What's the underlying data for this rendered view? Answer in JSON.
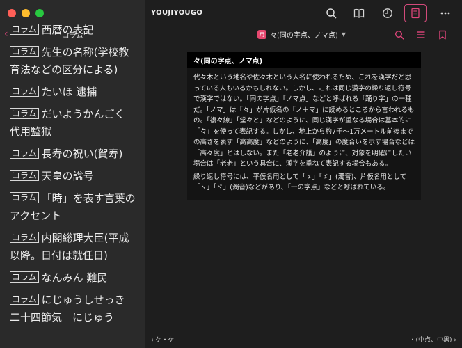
{
  "window": {
    "app_title": "YOUJIYOUGO"
  },
  "sidebar": {
    "title": "コラム",
    "items": [
      {
        "tag": "コラム",
        "text": "西暦の表記"
      },
      {
        "tag": "コラム",
        "text": "先生の名称(学校教育法などの区分による)"
      },
      {
        "tag": "コラム",
        "text": "たいほ 逮捕"
      },
      {
        "tag": "コラム",
        "text": "だいようかんごく 代用監獄"
      },
      {
        "tag": "コラム",
        "text": "長寿の祝い(賀寿)"
      },
      {
        "tag": "コラム",
        "text": "天皇の諡号"
      },
      {
        "tag": "コラム",
        "text": "「時」を表す言葉のアクセント"
      },
      {
        "tag": "コラム",
        "text": "内閣総理大臣(平成以降。日付は就任日)"
      },
      {
        "tag": "コラム",
        "text": "なんみん 難民"
      },
      {
        "tag": "コラム",
        "text": "にじゅうしせっき 二十四節気　にじゅう"
      }
    ]
  },
  "toolbar": {
    "icons": [
      "search-icon",
      "book-icon",
      "history-icon",
      "document-icon",
      "more-icon"
    ]
  },
  "subbar": {
    "app_icon_label": "用",
    "article_title": "々(同の字点、ノマ点)"
  },
  "article": {
    "heading": "々(同の字点、ノマ点)",
    "paragraph1": "代々木という地名や佐々木という人名に使われるため、これを漢字だと思っている人もいるかもしれない。しかし、これは同じ漢字の繰り返し符号で漢字ではない。「同の字点」「ノマ点」などと呼ばれる「踊り字」の一種だ。「ノマ」は「々」が片仮名の「ノ＋マ」に読めるところから言われるもの。「複々線」「堂々と」などのように、同じ漢字が重なる場合は基本的に「々」を使って表記する。しかし、地上から約7千〜1万メートル前後までの高さを表す「高高度」などのように、「高度」の度合いを示す場合などは「高々度」とはしない。また「老老介護」のように、対象を明確にしたい場合は「老老」という具合に、漢字を重ねて表記する場合もある。",
    "paragraph2": "繰り返し符号には、平仮名用として「ゝ」「ゞ」(濁音)、片仮名用として「ヽ」「ヾ」(濁音)などがあり、「一の字点」などと呼ばれている。"
  },
  "bottombar": {
    "prev": "ケ・ケ",
    "next": "・(中点、中黒)"
  }
}
